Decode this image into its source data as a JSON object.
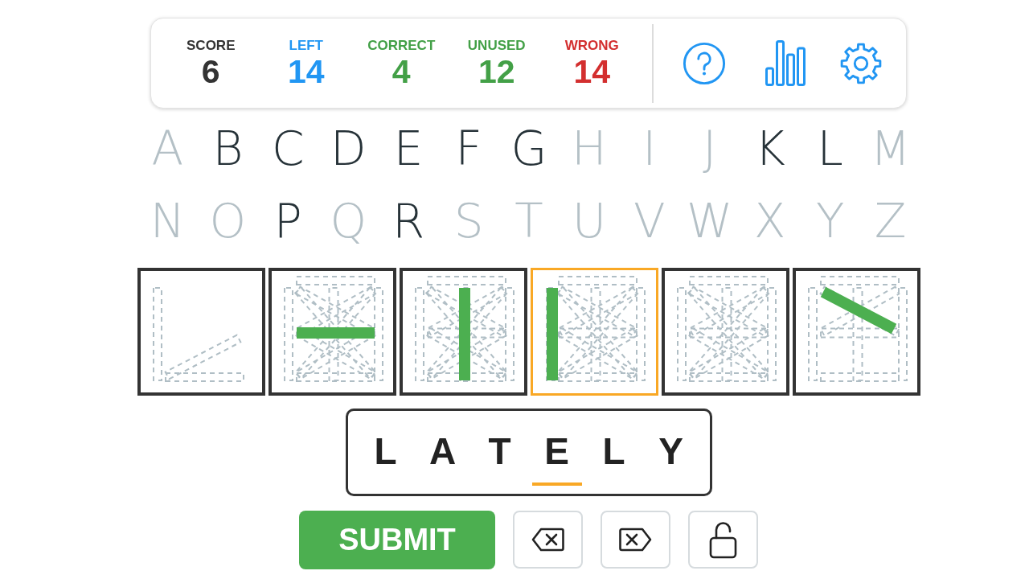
{
  "stats": [
    {
      "label": "SCORE",
      "value": "6",
      "color": "#333333"
    },
    {
      "label": "LEFT",
      "value": "14",
      "color": "#2196f3"
    },
    {
      "label": "CORRECT",
      "value": "4",
      "color": "#43a047"
    },
    {
      "label": "UNUSED",
      "value": "12",
      "color": "#43a047"
    },
    {
      "label": "WRONG",
      "value": "14",
      "color": "#d32f2f"
    }
  ],
  "alphabet": [
    {
      "letter": "A",
      "disabled": true
    },
    {
      "letter": "B",
      "disabled": false
    },
    {
      "letter": "C",
      "disabled": false
    },
    {
      "letter": "D",
      "disabled": false
    },
    {
      "letter": "E",
      "disabled": false
    },
    {
      "letter": "F",
      "disabled": false
    },
    {
      "letter": "G",
      "disabled": false
    },
    {
      "letter": "H",
      "disabled": true
    },
    {
      "letter": "I",
      "disabled": true
    },
    {
      "letter": "J",
      "disabled": true
    },
    {
      "letter": "K",
      "disabled": false
    },
    {
      "letter": "L",
      "disabled": false
    },
    {
      "letter": "M",
      "disabled": true
    },
    {
      "letter": "N",
      "disabled": true
    },
    {
      "letter": "O",
      "disabled": true
    },
    {
      "letter": "P",
      "disabled": false
    },
    {
      "letter": "Q",
      "disabled": true
    },
    {
      "letter": "R",
      "disabled": false
    },
    {
      "letter": "S",
      "disabled": true
    },
    {
      "letter": "T",
      "disabled": true
    },
    {
      "letter": "U",
      "disabled": true
    },
    {
      "letter": "V",
      "disabled": true
    },
    {
      "letter": "W",
      "disabled": true
    },
    {
      "letter": "X",
      "disabled": true
    },
    {
      "letter": "Y",
      "disabled": true
    },
    {
      "letter": "Z",
      "disabled": true
    }
  ],
  "tiles": [
    {
      "kind": "corner",
      "selected": false
    },
    {
      "kind": "middle",
      "selected": false
    },
    {
      "kind": "center",
      "selected": false
    },
    {
      "kind": "left",
      "selected": true
    },
    {
      "kind": "blank",
      "selected": false
    },
    {
      "kind": "diagonal",
      "selected": false
    }
  ],
  "word": [
    {
      "char": "L",
      "selected": false
    },
    {
      "char": "A",
      "selected": false
    },
    {
      "char": "T",
      "selected": false
    },
    {
      "char": "E",
      "selected": true
    },
    {
      "char": "L",
      "selected": false
    },
    {
      "char": "Y",
      "selected": false
    }
  ],
  "submit_button": {
    "label": "SUBMIT"
  }
}
